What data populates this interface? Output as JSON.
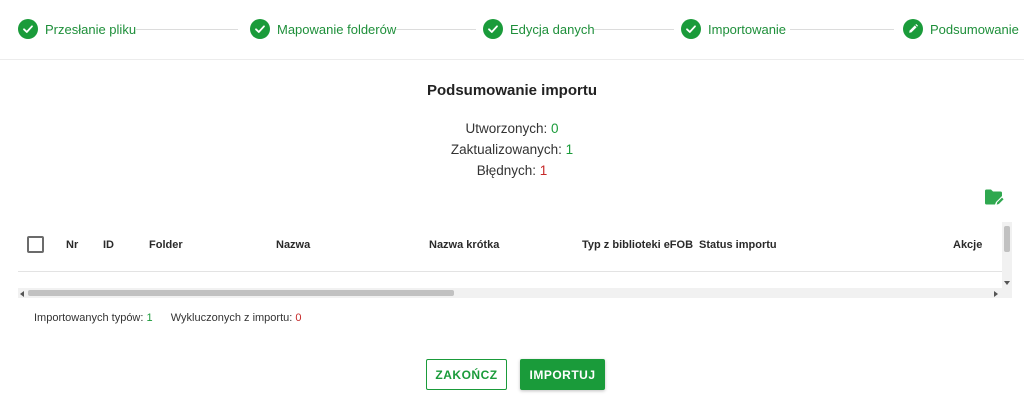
{
  "stepper": {
    "steps": [
      {
        "label": "Przesłanie pliku",
        "state": "done"
      },
      {
        "label": "Mapowanie folderów",
        "state": "done"
      },
      {
        "label": "Edycja danych",
        "state": "done"
      },
      {
        "label": "Importowanie",
        "state": "done"
      },
      {
        "label": "Podsumowanie",
        "state": "current"
      }
    ]
  },
  "summary": {
    "title": "Podsumowanie importu",
    "created_label": "Utworzonych:",
    "created_value": "0",
    "updated_label": "Zaktualizowanych:",
    "updated_value": "1",
    "errors_label": "Błędnych:",
    "errors_value": "1"
  },
  "table": {
    "columns": [
      "Nr",
      "ID",
      "Folder",
      "Nazwa",
      "Nazwa krótka",
      "Typ z biblioteki eFOB",
      "Status importu",
      "Akcje"
    ],
    "rows": []
  },
  "counts": {
    "imported_label": "Importowanych typów:",
    "imported_value": "1",
    "excluded_label": "Wykluczonych z importu:",
    "excluded_value": "0"
  },
  "buttons": {
    "finish": "ZAKOŃCZ",
    "import": "IMPORTUJ"
  },
  "colors": {
    "accent": "#1a9b3a",
    "error": "#c62828"
  },
  "icons": {
    "done_step": "check-icon",
    "current_step": "pencil-icon",
    "table_action": "folder-edit-icon"
  }
}
